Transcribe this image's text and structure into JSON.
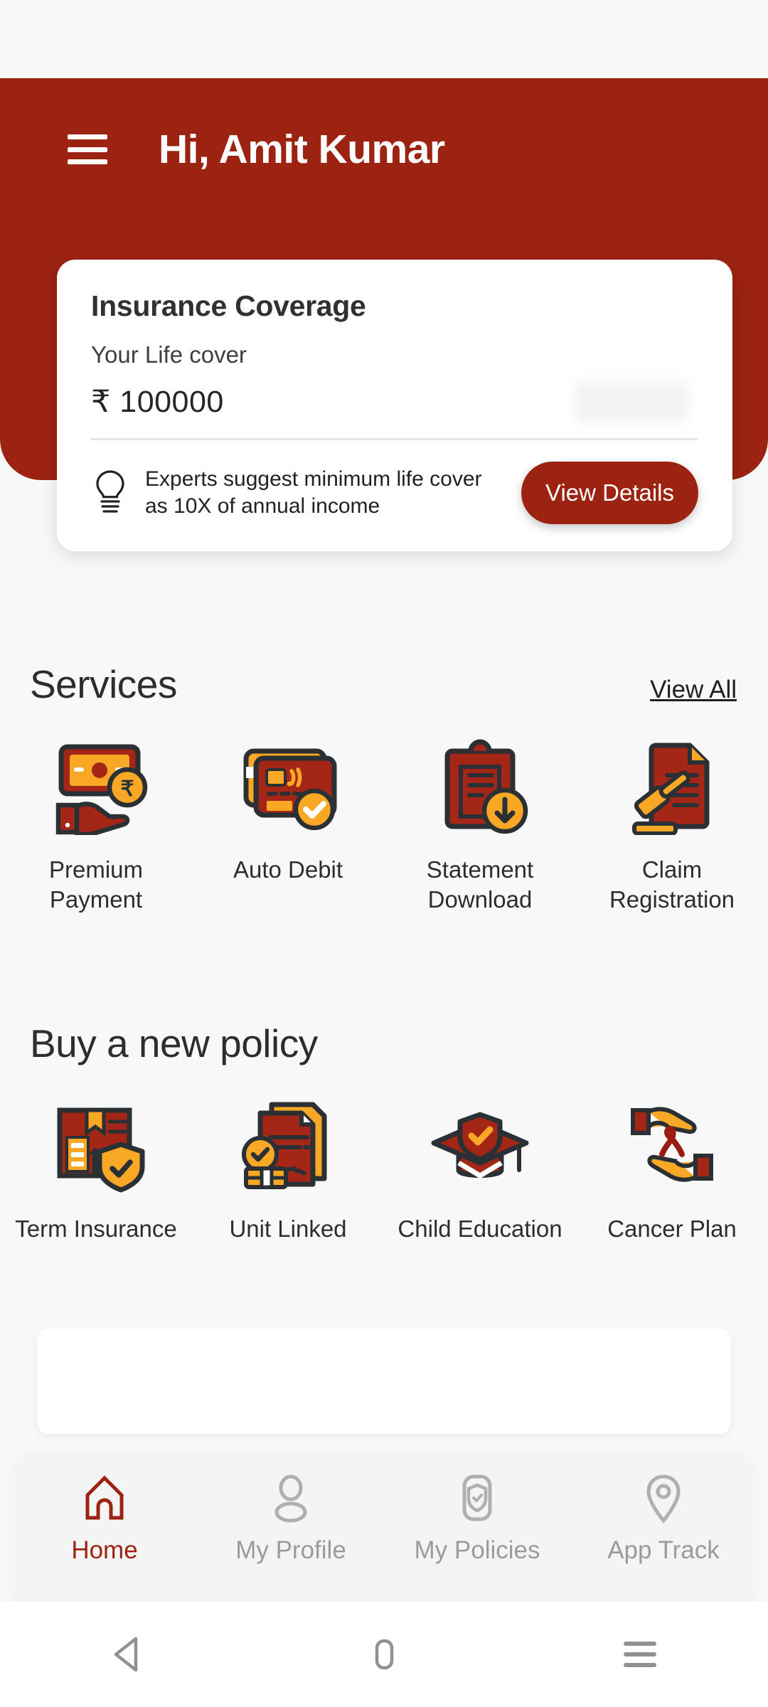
{
  "brand": {
    "red": "#9C2211",
    "orange": "#F5A623",
    "bg": "#F8F8F8",
    "dark": "#2F3233"
  },
  "header": {
    "menu_icon": "hamburger-menu-icon",
    "greeting": "Hi, Amit Kumar"
  },
  "coverage_card": {
    "title": "Insurance Coverage",
    "subtitle": "Your Life cover",
    "amount": "₹ 100000",
    "tip_icon": "lightbulb-icon",
    "tip_text": "Experts suggest minimum life cover as 10X of annual income",
    "cta_label": "View Details"
  },
  "services": {
    "title": "Services",
    "view_all_label": "View All",
    "items": [
      {
        "label": "Premium Payment",
        "icon": "hand-holding-cash-rupee-icon"
      },
      {
        "label": "Auto Debit",
        "icon": "credit-card-check-icon"
      },
      {
        "label": "Statement Download",
        "icon": "clipboard-download-icon"
      },
      {
        "label": "Claim Registration",
        "icon": "document-gavel-icon"
      }
    ]
  },
  "buy_policy": {
    "title": "Buy a new policy",
    "items": [
      {
        "label": "Term Insurance",
        "icon": "document-shield-check-icon"
      },
      {
        "label": "Unit Linked",
        "icon": "signed-document-coins-icon"
      },
      {
        "label": "Child Education",
        "icon": "graduation-cap-shield-icon"
      },
      {
        "label": "Cancer Plan",
        "icon": "hands-ribbon-icon"
      }
    ]
  },
  "bottom_nav": {
    "items": [
      {
        "label": "Home",
        "icon": "home-icon",
        "active": true
      },
      {
        "label": "My Profile",
        "icon": "person-icon",
        "active": false
      },
      {
        "label": "My Policies",
        "icon": "shield-document-icon",
        "active": false
      },
      {
        "label": "App Track",
        "icon": "map-pin-icon",
        "active": false
      }
    ]
  },
  "system_nav": {
    "back": "back-triangle-icon",
    "home": "home-pill-icon",
    "recents": "recents-menu-icon"
  }
}
